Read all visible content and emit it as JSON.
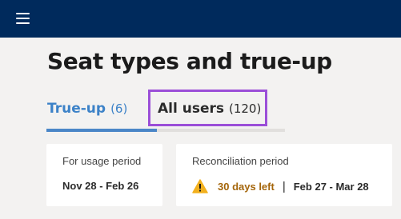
{
  "header": {
    "menu_icon": "hamburger-menu-icon",
    "background_color": "#002a5c"
  },
  "page": {
    "title": "Seat types and true-up"
  },
  "tabs": [
    {
      "label": "True-up",
      "count": "(6)",
      "selected": true,
      "color": "#3c82c8"
    },
    {
      "label": "All users",
      "count": "(120)",
      "selected": false,
      "highlight_color": "#9b4fd8"
    }
  ],
  "usage_card": {
    "label": "For usage period",
    "value": "Nov 28 - Feb 26"
  },
  "reconciliation_card": {
    "label": "Reconciliation period",
    "warning_icon": "warning-icon",
    "days_left": "30 days left",
    "separator": "|",
    "range": "Feb 27 - Mar 28",
    "warning_color": "#a4650a"
  }
}
